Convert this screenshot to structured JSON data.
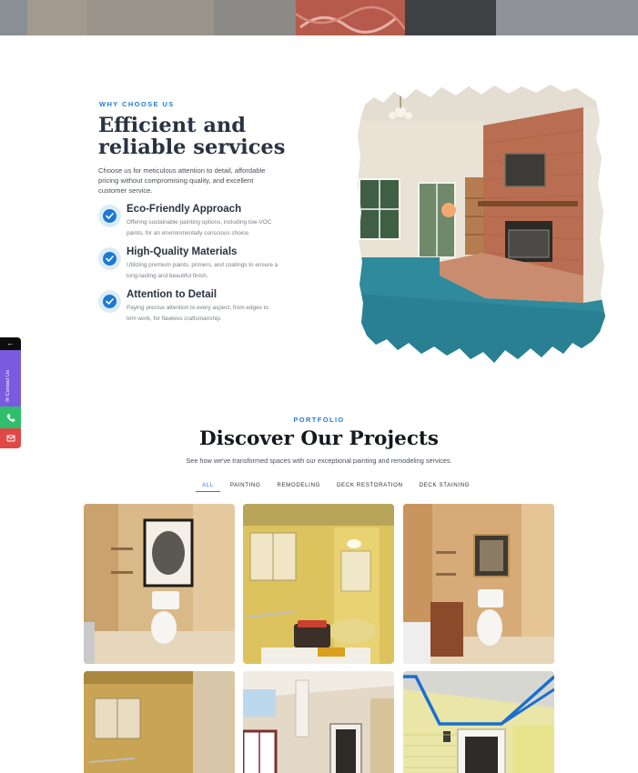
{
  "why": {
    "eyebrow": "WHY CHOOSE US",
    "title": "Efficient and reliable services",
    "description": "Choose us for meticulous attention to detail, affordable pricing without compromising quality, and excellent customer service.",
    "features": [
      {
        "title": "Eco-Friendly Approach",
        "description": "Offering sustainable painting options, including low-VOC paints, for an environmentally conscious choice.",
        "icon": "check-circle-icon"
      },
      {
        "title": "High-Quality Materials",
        "description": "Utilizing premium paints, primers, and coatings to ensure a long-lasting and beautiful finish.",
        "icon": "check-circle-icon"
      },
      {
        "title": "Attention to Detail",
        "description": "Paying precise attention to every aspect, from edges to trim work, for flawless craftsmanship.",
        "icon": "check-circle-icon"
      }
    ]
  },
  "side_widget": {
    "arrow": "←",
    "contact_label": "✉ Contact Us",
    "icons": [
      "arrow-left-icon",
      "envelope-icon",
      "phone-icon",
      "mail-icon"
    ],
    "colors": {
      "arrow": "#0d0d0d",
      "contact": "#7a5ae0",
      "phone": "#2fbf6a",
      "mail": "#e04848"
    }
  },
  "portfolio": {
    "eyebrow": "PORTFOLIO",
    "title": "Discover Our Projects",
    "description": "See how we've transformed spaces with our exceptional painting and remodeling services.",
    "tabs": [
      "ALL",
      "PAINTING",
      "REMODELING",
      "DECK RESTORATION",
      "DECK STAINING"
    ],
    "active_tab": "ALL"
  },
  "colors": {
    "accent": "#1f7fd4",
    "heading": "#2a3340",
    "check": "#1b78d6"
  }
}
